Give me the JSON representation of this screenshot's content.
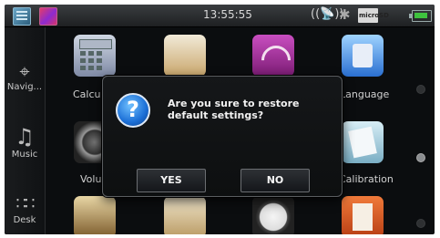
{
  "statusbar": {
    "time": "13:55:55",
    "signal_icon": "radio-antenna-icon",
    "bluetooth_icon": "bluetooth-icon",
    "sd_card_label": "microSD",
    "battery_icon": "battery-icon"
  },
  "sidebar": {
    "items": [
      {
        "label": "Navig...",
        "icon": "navigation-crosshair-icon"
      },
      {
        "label": "Music",
        "icon": "music-note-icon"
      },
      {
        "label": "Desk",
        "icon": "desk-grid-icon"
      }
    ]
  },
  "grid": {
    "apps": [
      {
        "label": "Calcul",
        "icon": "calculator-icon"
      },
      {
        "label": "",
        "icon": "tools-icon"
      },
      {
        "label": "",
        "icon": "wifi-icon"
      },
      {
        "label": "Language",
        "icon": "language-icon"
      },
      {
        "label": "Volu",
        "icon": "volume-speaker-icon"
      },
      {
        "label": "Calibration",
        "icon": "calibration-icon"
      },
      {
        "label": "",
        "icon": "game-icon"
      },
      {
        "label": "",
        "icon": "notes-icon"
      },
      {
        "label": "",
        "icon": "clock-icon"
      },
      {
        "label": "",
        "icon": "document-icon"
      }
    ]
  },
  "dialog": {
    "message": "Are you sure to restore default settings?",
    "icon": "question-icon",
    "yes_label": "YES",
    "no_label": "NO"
  },
  "colors": {
    "background": "#0b0d0f",
    "dialog_border": "#5a5d60",
    "question_icon": "#1c6fd6",
    "battery_fill": "#3ec23e"
  }
}
